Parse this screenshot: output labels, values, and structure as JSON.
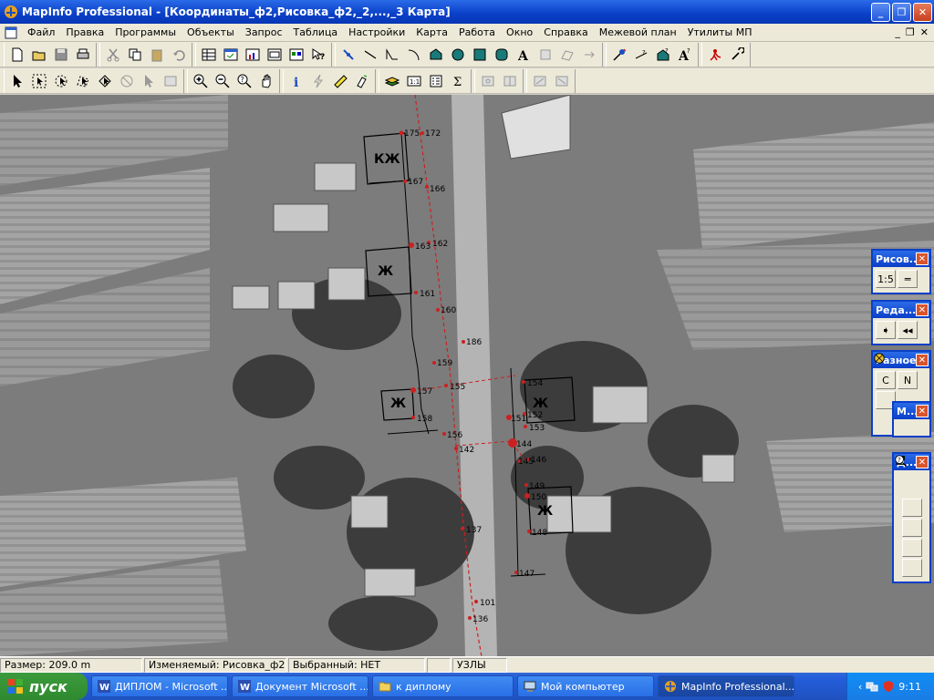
{
  "window": {
    "title": "MapInfo Professional - [Координаты_ф2,Рисовка_ф2,_2,...,_3 Карта]",
    "min_label": "_",
    "max_label": "❐",
    "close_label": "✕"
  },
  "menu": {
    "items": [
      "Файл",
      "Правка",
      "Программы",
      "Объекты",
      "Запрос",
      "Таблица",
      "Настройки",
      "Карта",
      "Работа",
      "Окно",
      "Справка",
      "Межевой план",
      "Утилиты МП"
    ],
    "mdi_min": "_",
    "mdi_restore": "❐",
    "mdi_close": "✕"
  },
  "map": {
    "parcel_labels": [
      "КЖ",
      "Ж",
      "Ж",
      "Ж",
      "Ж"
    ],
    "points": [
      "175",
      "172",
      "167",
      "166",
      "163",
      "162",
      "161",
      "160",
      "186",
      "159",
      "155",
      "157",
      "158",
      "156",
      "154",
      "151",
      "152",
      "153",
      "144",
      "142",
      "145",
      "146",
      "149",
      "150",
      "148",
      "137",
      "147",
      "101",
      "136"
    ]
  },
  "palettes": {
    "drawing": {
      "title": "Рисов...",
      "b1": "1:5",
      "b2": "═"
    },
    "editing": {
      "title": "Реда...",
      "b1": "➧",
      "b2": "◂◂"
    },
    "misc": {
      "title": "Разное",
      "b1": "C",
      "b2": "N"
    },
    "m": {
      "title": "М..."
    },
    "d": {
      "title": "Д..."
    }
  },
  "status": {
    "size": "Размер: 209.0 m",
    "editable": "Изменяемый: Рисовка_ф2",
    "selected": "Выбранный: НЕТ",
    "empty": "",
    "snap": "УЗЛЫ"
  },
  "taskbar": {
    "start": "пуск",
    "tasks": [
      "ДИПЛОМ - Microsoft ...",
      "Документ Microsoft ...",
      "к диплому",
      "Мой компьютер",
      "MapInfo Professional..."
    ],
    "clock": "9:11"
  },
  "colors": {
    "title_blue": "#0a3fc8",
    "taskbar_blue": "#245edb",
    "start_green": "#3c9a3c",
    "boundary_red": "#cc2020"
  }
}
